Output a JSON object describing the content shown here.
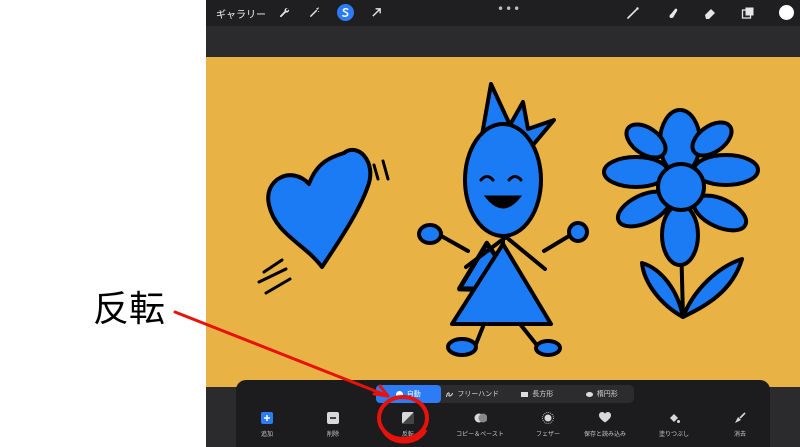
{
  "topbar": {
    "gallery_label": "ギャラリー",
    "dots": "•••",
    "left_tools": [
      "wrench-icon",
      "magic-wand-icon",
      "selection-icon",
      "transform-arrow-icon"
    ],
    "right_tools": [
      "brush-icon",
      "smudge-icon",
      "eraser-icon",
      "layers-icon",
      "color-swatch"
    ],
    "active_tool": "selection-icon",
    "current_color": "#ffffff"
  },
  "canvas": {
    "background_color": "#e9b244",
    "drawing_color": "#1b7bf5",
    "objects": [
      "heart",
      "stick-figure",
      "flower"
    ]
  },
  "selection_toolbar": {
    "modes": [
      {
        "label": "自動",
        "icon": "circle-icon",
        "active": true
      },
      {
        "label": "フリーハンド",
        "icon": "freehand-icon",
        "active": false
      },
      {
        "label": "長方形",
        "icon": "rectangle-icon",
        "active": false
      },
      {
        "label": "楕円形",
        "icon": "ellipse-icon",
        "active": false
      }
    ],
    "actions": [
      {
        "label": "追加",
        "icon": "add-icon"
      },
      {
        "label": "削除",
        "icon": "remove-icon"
      },
      {
        "label": "反転",
        "icon": "invert-icon"
      },
      {
        "label": "コピー＆ペースト",
        "icon": "copy-paste-icon"
      },
      {
        "label": "フェザー",
        "icon": "feather-icon"
      },
      {
        "label": "保存と読み込み",
        "icon": "heart-icon"
      },
      {
        "label": "塗りつぶし",
        "icon": "fill-icon"
      },
      {
        "label": "消去",
        "icon": "clear-icon"
      }
    ]
  },
  "annotation": {
    "callout_text": "反転",
    "color": "#e8120c",
    "target": "反転"
  },
  "colors": {
    "accent": "#2b7cf6",
    "toolbar_bg": "#1c1c1e",
    "topbar_bg": "#1f1f21"
  }
}
